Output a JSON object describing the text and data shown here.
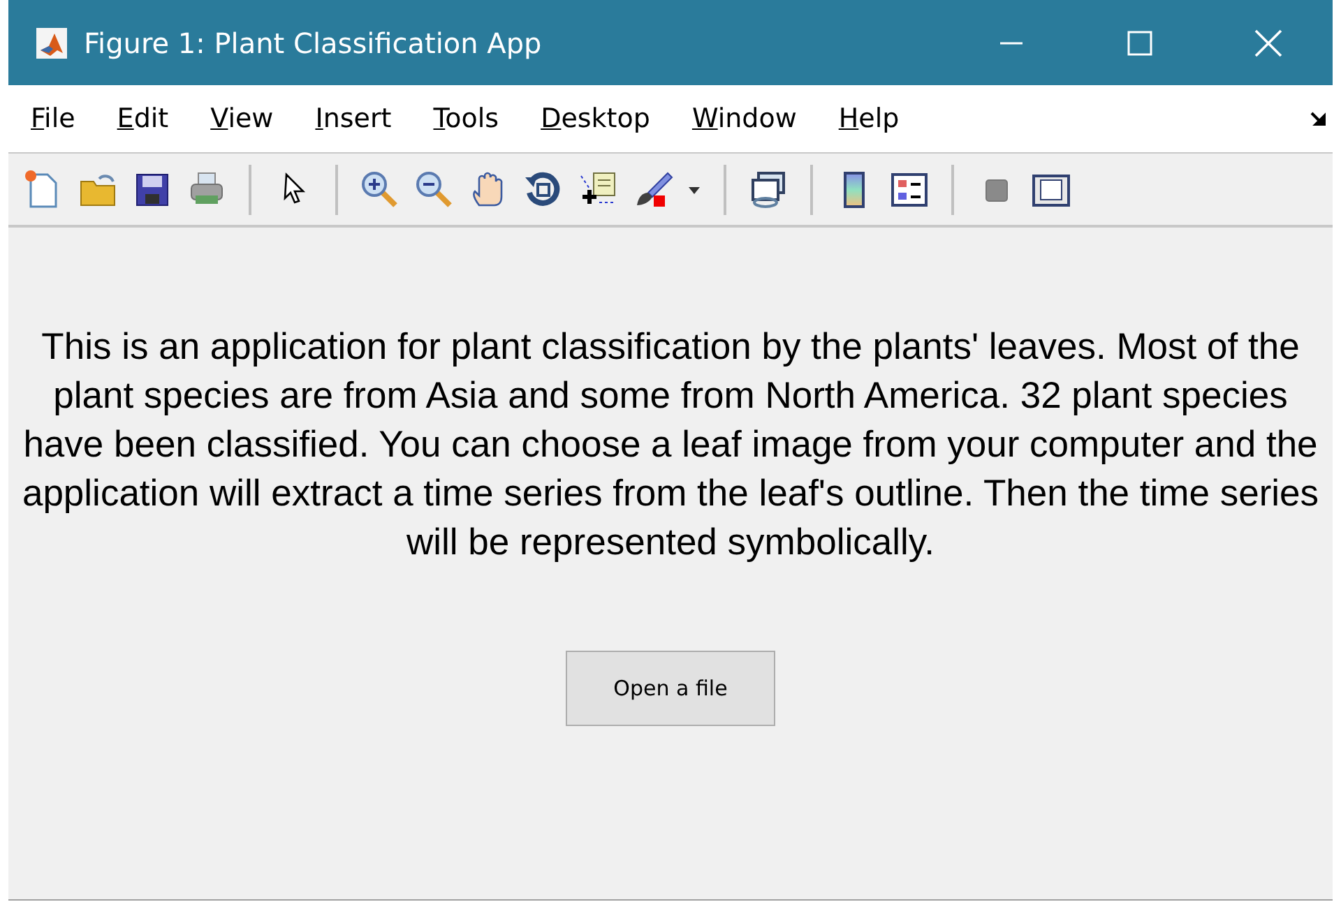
{
  "window": {
    "title": "Figure 1: Plant Classification App"
  },
  "menu": [
    {
      "label": "File"
    },
    {
      "label": "Edit"
    },
    {
      "label": "View"
    },
    {
      "label": "Insert"
    },
    {
      "label": "Tools"
    },
    {
      "label": "Desktop"
    },
    {
      "label": "Window"
    },
    {
      "label": "Help"
    }
  ],
  "description": "This is an application for plant classification by the plants' leaves. Most of the plant species are from Asia and some from North America. 32 plant species have been classified. You can choose a leaf image from your computer and the application will extract a time series from the leaf's outline. Then the time series will be represented symbolically.",
  "button": {
    "label": "Open a file"
  }
}
